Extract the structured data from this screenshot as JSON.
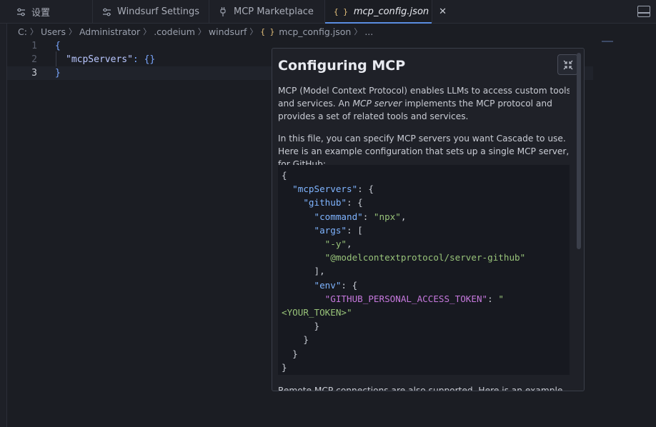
{
  "tabs": [
    {
      "label": "设置",
      "icon": "settings-sliders-icon"
    },
    {
      "label": "Windsurf Settings",
      "icon": "settings-sliders-icon"
    },
    {
      "label": "MCP Marketplace",
      "icon": "plug-icon"
    },
    {
      "label": "mcp_config.json",
      "icon": "json-braces-icon",
      "active": true
    }
  ],
  "breadcrumb": [
    "C:",
    "Users",
    "Administrator",
    ".codeium",
    "windsurf",
    "mcp_config.json",
    "..."
  ],
  "editor": {
    "line_numbers": [
      "1",
      "2",
      "3"
    ],
    "lines": [
      {
        "punct": "{"
      },
      {
        "key": "\"mcpServers\"",
        "rest": ": {}"
      },
      {
        "punct": "}"
      }
    ]
  },
  "panel": {
    "title": "Configuring MCP",
    "para1_a": "MCP (Model Context Protocol) enables LLMs to access custom tools and services. An ",
    "para1_em": "MCP server",
    "para1_b": " implements the MCP protocol and provides a set of related tools and services.",
    "para2": "In this file, you can specify MCP servers you want Cascade to use. Here is an example configuration that sets up a single MCP server, for GitHub:",
    "para3": "Remote MCP connections are also supported. Here is an example",
    "code": {
      "mcpServers": "\"mcpServers\"",
      "github": "\"github\"",
      "command_key": "\"command\"",
      "command_val": "\"npx\"",
      "args_key": "\"args\"",
      "arg1": "\"-y\"",
      "arg2": "\"@modelcontextprotocol/server-github\"",
      "env_key": "\"env\"",
      "token_key": "\"GITHUB_PERSONAL_ACCESS_TOKEN\"",
      "token_val_a": "\"",
      "token_val_b": "<YOUR_TOKEN>\""
    }
  },
  "colors": {
    "accent": "#5a8de0",
    "background": "#1b1d23",
    "panel": "#1f2128"
  }
}
